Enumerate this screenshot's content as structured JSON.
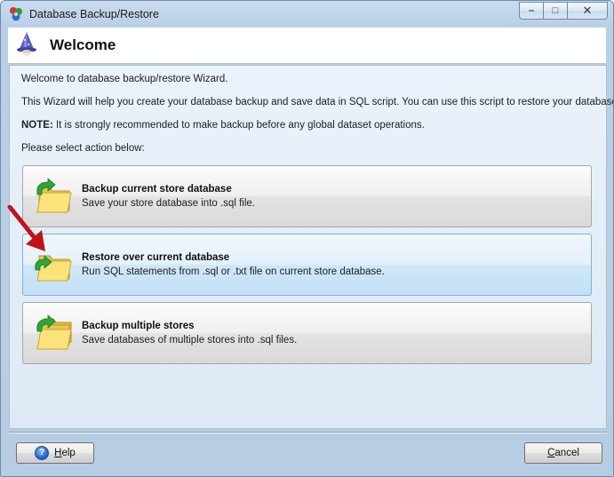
{
  "window": {
    "title": "Database Backup/Restore",
    "minimize_glyph": "–",
    "maximize_glyph": "□",
    "close_glyph": "✕"
  },
  "header": {
    "title": "Welcome"
  },
  "content": {
    "line1": "Welcome to database backup/restore Wizard.",
    "line2": "This Wizard will help you create your database backup and save data in SQL script. You can use this script to restore your database.",
    "note_label": "NOTE:",
    "note_text": " It is strongly recommended to make backup before any global dataset operations.",
    "line4": "Please select action below:"
  },
  "options": [
    {
      "title": "Backup current store database",
      "desc": "Save your store database into .sql file.",
      "icon": "folder-backup-icon"
    },
    {
      "title": "Restore over current database",
      "desc": "Run SQL statements from .sql or .txt file on current store database.",
      "icon": "folder-restore-icon"
    },
    {
      "title": "Backup multiple stores",
      "desc": "Save databases of multiple stores into .sql files.",
      "icon": "folders-multiple-icon"
    }
  ],
  "footer": {
    "help_first": "H",
    "help_rest": "elp",
    "cancel_first": "C",
    "cancel_rest": "ancel"
  },
  "colors": {
    "accent_selected": "#c3e0f5",
    "arrow": "#c0141b"
  }
}
